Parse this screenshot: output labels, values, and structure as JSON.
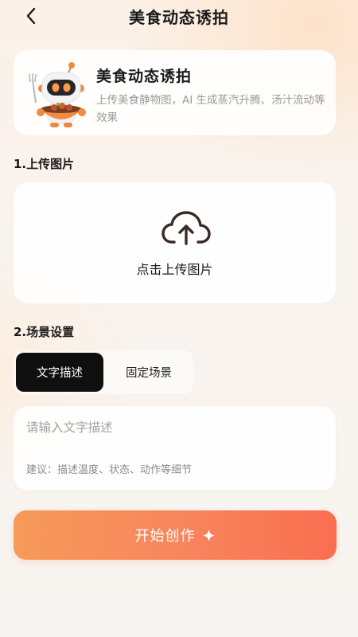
{
  "header": {
    "title": "美食动态诱拍",
    "back_icon": "chevron-left-icon"
  },
  "intro": {
    "title": "美食动态诱拍",
    "description": "上传美食静物图，AI 生成蒸汽升腾、汤汁流动等效果",
    "mascot_icon": "robot-chef-mascot"
  },
  "upload": {
    "section_label": "1.上传图片",
    "prompt": "点击上传图片",
    "icon": "cloud-upload-icon"
  },
  "scene": {
    "section_label": "2.场景设置",
    "tabs": [
      {
        "label": "文字描述",
        "active": true
      },
      {
        "label": "固定场景",
        "active": false
      }
    ],
    "input": {
      "placeholder": "请输入文字描述",
      "value": ""
    },
    "hint": "建议：描述温度、状态、动作等细节"
  },
  "action": {
    "label": "开始创作",
    "icon": "sparkle-icon"
  },
  "colors": {
    "accent_start": "#f79a5a",
    "accent_end": "#fa6e4f",
    "active_tab_bg": "#0f0f0f",
    "background": "#f9f3ee"
  }
}
